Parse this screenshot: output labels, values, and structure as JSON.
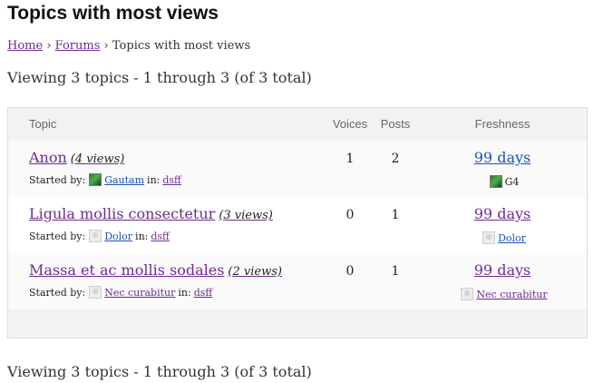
{
  "page": {
    "title": "Topics with most views"
  },
  "breadcrumb": {
    "home": "Home",
    "forums": "Forums",
    "separator": "›",
    "current": "Topics with most views"
  },
  "pagination": {
    "count_text": "Viewing 3 topics - 1 through 3 (of 3 total)"
  },
  "table": {
    "headers": {
      "topic": "Topic",
      "voices": "Voices",
      "posts": "Posts",
      "freshness": "Freshness"
    },
    "rows": [
      {
        "title": "Anon",
        "views": "(4 views)",
        "started_by_label": "Started by:",
        "author": "Gautam",
        "author_avatar": "green-avatar",
        "in_label": "in:",
        "forum": "dsff",
        "voices": "1",
        "posts": "2",
        "freshness": "99 days",
        "last_author": "G4",
        "last_author_avatar": "green-avatar"
      },
      {
        "title": "Ligula mollis consectetur",
        "views": "(3 views)",
        "started_by_label": "Started by:",
        "author": "Dolor",
        "author_avatar": "default-avatar",
        "in_label": "in:",
        "forum": "dsff",
        "voices": "0",
        "posts": "1",
        "freshness": "99 days",
        "last_author": "Dolor",
        "last_author_avatar": "default-avatar"
      },
      {
        "title": "Massa et ac mollis sodales",
        "views": "(2 views)",
        "started_by_label": "Started by:",
        "author": "Nec curabitur",
        "author_avatar": "default-avatar",
        "in_label": "in:",
        "forum": "dsff",
        "voices": "0",
        "posts": "1",
        "freshness": "99 days",
        "last_author": "Nec curabitur",
        "last_author_avatar": "default-avatar"
      }
    ]
  },
  "colors": {
    "visited_link": "#6e2c91",
    "link": "#1a52b3",
    "header_bg": "#f2f2f2",
    "border": "#dddddd"
  }
}
